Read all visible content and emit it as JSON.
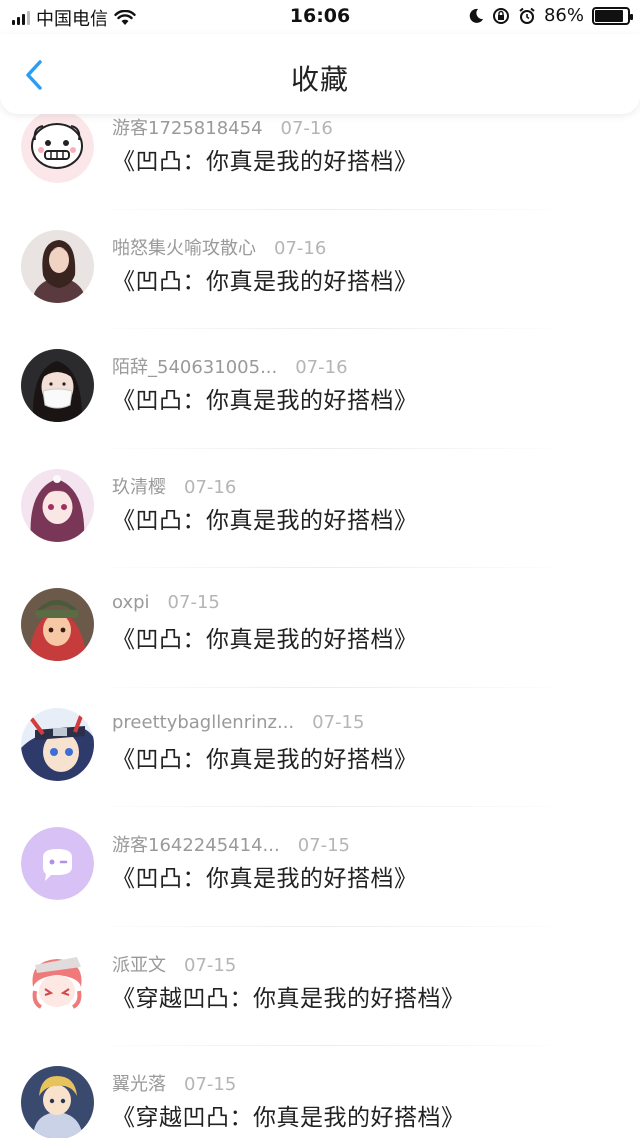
{
  "status_bar": {
    "carrier": "中国电信",
    "time": "16:06",
    "battery_percent": "86%",
    "battery_level": 0.86,
    "icons": [
      "signal-icon",
      "wifi-icon",
      "moon-icon",
      "rotation-lock-icon",
      "alarm-icon",
      "battery-icon"
    ]
  },
  "nav": {
    "title": "收藏",
    "back_icon": "chevron-left-icon",
    "accent": "#2a9df4"
  },
  "items": [
    {
      "user": "游客1725818454",
      "date": "07-16",
      "title": "《凹凸：你真是我的好搭档》",
      "avatar": "cartoon-face"
    },
    {
      "user": "啪怒集火喻攻散心",
      "date": "07-16",
      "title": "《凹凸：你真是我的好搭档》",
      "avatar": "girl-photo"
    },
    {
      "user": "陌辞_540631005...",
      "date": "07-16",
      "title": "《凹凸：你真是我的好搭档》",
      "avatar": "mask-girl"
    },
    {
      "user": "玖清樱",
      "date": "07-16",
      "title": "《凹凸：你真是我的好搭档》",
      "avatar": "anime-pink"
    },
    {
      "user": "oxpi",
      "date": "07-15",
      "title": "《凹凸：你真是我的好搭档》",
      "avatar": "anime-red"
    },
    {
      "user": "preettybagllenrinz...",
      "date": "07-15",
      "title": "《凹凸：你真是我的好搭档》",
      "avatar": "anime-ninja"
    },
    {
      "user": "游客1642245414...",
      "date": "07-15",
      "title": "《凹凸：你真是我的好搭档》",
      "avatar": "default-chat"
    },
    {
      "user": "派亚文",
      "date": "07-15",
      "title": "《穿越凹凸：你真是我的好搭档》",
      "avatar": "anime-chibi"
    },
    {
      "user": "翼光落",
      "date": "07-15",
      "title": "《穿越凹凸：你真是我的好搭档》",
      "avatar": "anime-blonde"
    }
  ]
}
